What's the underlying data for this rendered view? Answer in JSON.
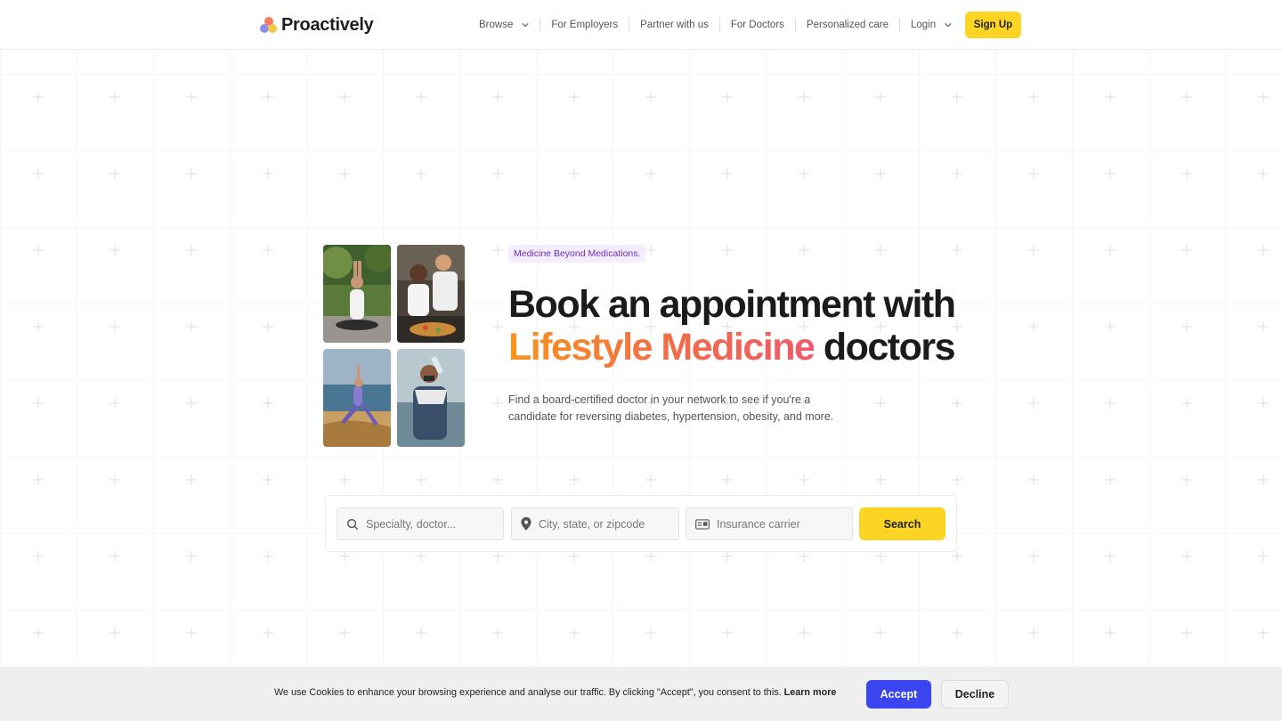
{
  "brand": {
    "name": "Proactively"
  },
  "nav": {
    "items": [
      {
        "label": "Browse",
        "dropdown": true
      },
      {
        "label": "For Employers",
        "dropdown": false
      },
      {
        "label": "Partner with us",
        "dropdown": false
      },
      {
        "label": "For Doctors",
        "dropdown": false
      },
      {
        "label": "Personalized care",
        "dropdown": false
      },
      {
        "label": "Login",
        "dropdown": true
      }
    ],
    "signup_label": "Sign Up"
  },
  "hero": {
    "tagline": "Medicine Beyond Medications.",
    "headline_line1": "Book an appointment with",
    "headline_highlight": "Lifestyle Medicine",
    "headline_end": "doctors",
    "subtext": "Find a board-certified doctor in your network to see if you're a candidate for reversing diabetes, hypertension, obesity, and more.",
    "photos": [
      {
        "icon": "yoga-meditation-photo"
      },
      {
        "icon": "couple-cooking-photo"
      },
      {
        "icon": "yoga-beach-photo"
      },
      {
        "icon": "man-drinking-water-photo"
      }
    ]
  },
  "search": {
    "specialty_placeholder": "Specialty, doctor...",
    "location_placeholder": "City, state, or zipcode",
    "insurance_placeholder": "Insurance carrier",
    "button_label": "Search"
  },
  "cookie": {
    "text": "We use Cookies to enhance your browsing experience and analyse our traffic. By clicking \"Accept\", you consent to this.",
    "learn_more": "Learn more",
    "accept_label": "Accept",
    "decline_label": "Decline"
  },
  "colors": {
    "accent_yellow": "#fcd524",
    "accept_blue": "#3b46f1",
    "tag_purple": "#6a2bbf",
    "gradient_start": "#f7941d",
    "gradient_end": "#ee5a6b"
  }
}
